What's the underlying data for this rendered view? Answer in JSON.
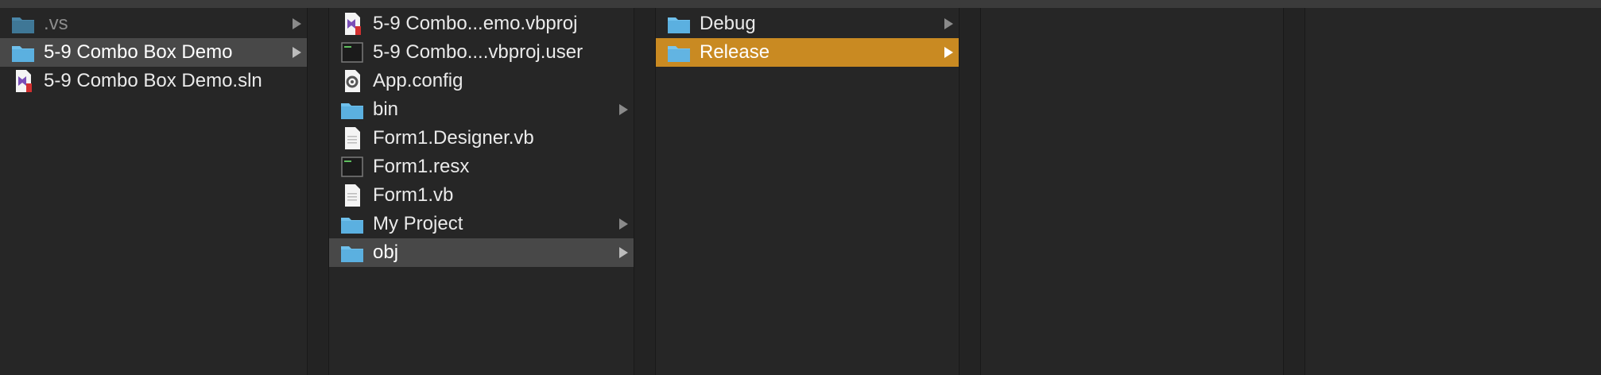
{
  "columns": [
    {
      "items": [
        {
          "label": ".vs",
          "icon": "folder-icon",
          "dim": true,
          "chevron": true
        },
        {
          "label": "5-9 Combo Box Demo",
          "icon": "folder-icon",
          "chevron": true,
          "selected": "gray"
        },
        {
          "label": "5-9 Combo Box Demo.sln",
          "icon": "visual-studio-solution-icon",
          "chevron": false
        }
      ]
    },
    {
      "items": [
        {
          "label": "5-9 Combo...emo.vbproj",
          "icon": "visual-studio-project-icon",
          "chevron": false
        },
        {
          "label": "5-9 Combo....vbproj.user",
          "icon": "terminal-file-icon",
          "chevron": false
        },
        {
          "label": "App.config",
          "icon": "config-gear-icon",
          "chevron": false
        },
        {
          "label": "bin",
          "icon": "folder-icon",
          "chevron": true
        },
        {
          "label": "Form1.Designer.vb",
          "icon": "text-file-icon",
          "chevron": false
        },
        {
          "label": "Form1.resx",
          "icon": "terminal-file-icon",
          "chevron": false
        },
        {
          "label": "Form1.vb",
          "icon": "text-file-icon",
          "chevron": false
        },
        {
          "label": "My Project",
          "icon": "folder-icon",
          "chevron": true
        },
        {
          "label": "obj",
          "icon": "folder-icon",
          "chevron": true,
          "selected": "gray"
        }
      ]
    },
    {
      "items": [
        {
          "label": "Debug",
          "icon": "folder-icon",
          "chevron": true
        },
        {
          "label": "Release",
          "icon": "folder-icon",
          "chevron": true,
          "selected": "orange"
        }
      ]
    },
    {
      "items": []
    },
    {
      "items": []
    }
  ],
  "colors": {
    "background": "#262626",
    "selection_gray": "#484848",
    "selection_orange": "#c98a22",
    "folder_blue": "#5bb0e0"
  }
}
